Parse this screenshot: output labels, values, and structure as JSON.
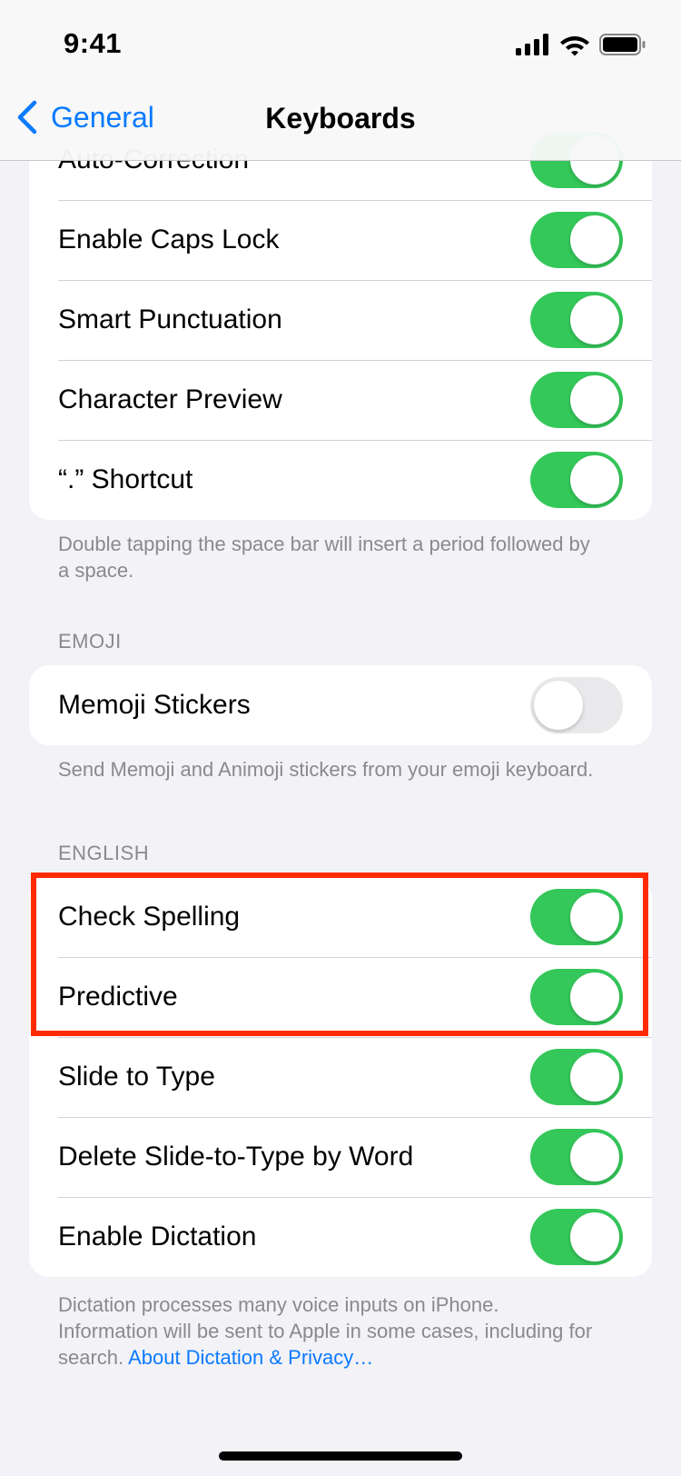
{
  "status": {
    "time": "9:41"
  },
  "nav": {
    "back_label": "General",
    "title": "Keyboards"
  },
  "group1": {
    "rows": [
      {
        "label": "Auto-Correction",
        "on": true
      },
      {
        "label": "Enable Caps Lock",
        "on": true
      },
      {
        "label": "Smart Punctuation",
        "on": true
      },
      {
        "label": "Character Preview",
        "on": true
      },
      {
        "label": "“.” Shortcut",
        "on": true
      }
    ],
    "footer": "Double tapping the space bar will insert a period followed by a space."
  },
  "emoji": {
    "header": "EMOJI",
    "rows": [
      {
        "label": "Memoji Stickers",
        "on": false
      }
    ],
    "footer": "Send Memoji and Animoji stickers from your emoji keyboard."
  },
  "english": {
    "header": "ENGLISH",
    "rows": [
      {
        "label": "Check Spelling",
        "on": true
      },
      {
        "label": "Predictive",
        "on": true
      },
      {
        "label": "Slide to Type",
        "on": true
      },
      {
        "label": "Delete Slide-to-Type by Word",
        "on": true
      },
      {
        "label": "Enable Dictation",
        "on": true
      }
    ],
    "footer": "Dictation processes many voice inputs on iPhone. Information will be sent to Apple in some cases, including for search.",
    "footer_link": "About Dictation & Privacy…"
  },
  "colors": {
    "accent": "#0a7aff",
    "toggle_on": "#34c759",
    "highlight": "#ff2a00"
  },
  "icons": [
    "chevron-left-icon",
    "cellular-signal-icon",
    "wifi-icon",
    "battery-icon"
  ]
}
